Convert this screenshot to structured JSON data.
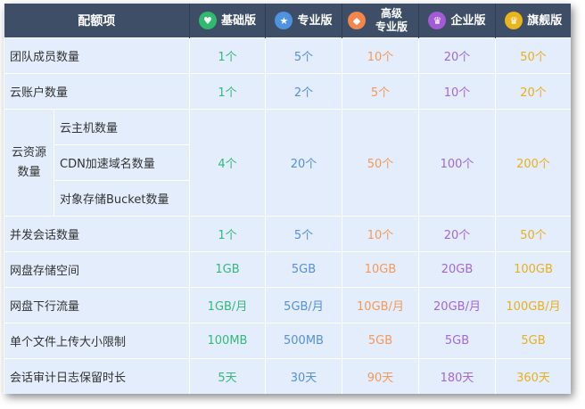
{
  "header": {
    "feature_col": "配额项",
    "plans": [
      {
        "label": "基础版",
        "icon": "heart-icon",
        "color": "#2fba6f"
      },
      {
        "label": "专业版",
        "icon": "star-icon",
        "color": "#4f93e0"
      },
      {
        "label": "高级专业版",
        "line1": "高级",
        "line2": "专业版",
        "icon": "gem-icon",
        "color": "#f5854a"
      },
      {
        "label": "企业版",
        "icon": "crown-icon",
        "color": "#a25ad6"
      },
      {
        "label": "旗舰版",
        "icon": "crown-icon",
        "color": "#e9b41c"
      }
    ]
  },
  "rows": [
    {
      "label": "团队成员数量",
      "values": [
        "1个",
        "5个",
        "10个",
        "20个",
        "50个"
      ]
    },
    {
      "label": "云账户数量",
      "values": [
        "1个",
        "2个",
        "5个",
        "10个",
        "20个"
      ]
    },
    {
      "group_line1": "云资源",
      "group_line2": "数量",
      "sublabels": [
        "云主机数量",
        "CDN加速域名数量",
        "对象存储Bucket数量"
      ],
      "values": [
        "4个",
        "20个",
        "50个",
        "100个",
        "200个"
      ]
    },
    {
      "label": "并发会话数量",
      "values": [
        "1个",
        "5个",
        "10个",
        "20个",
        "50个"
      ]
    },
    {
      "label": "网盘存储空间",
      "values": [
        "1GB",
        "5GB",
        "10GB",
        "20GB",
        "100GB"
      ]
    },
    {
      "label": "网盘下行流量",
      "values": [
        "1GB/月",
        "5GB/月",
        "10GB/月",
        "20GB/月",
        "100GB/月"
      ]
    },
    {
      "label": "单个文件上传大小限制",
      "values": [
        "100MB",
        "500MB",
        "5GB",
        "5GB",
        "5GB"
      ]
    },
    {
      "label": "会话审计日志保留时长",
      "values": [
        "5天",
        "30天",
        "90天",
        "180天",
        "360天"
      ]
    }
  ]
}
